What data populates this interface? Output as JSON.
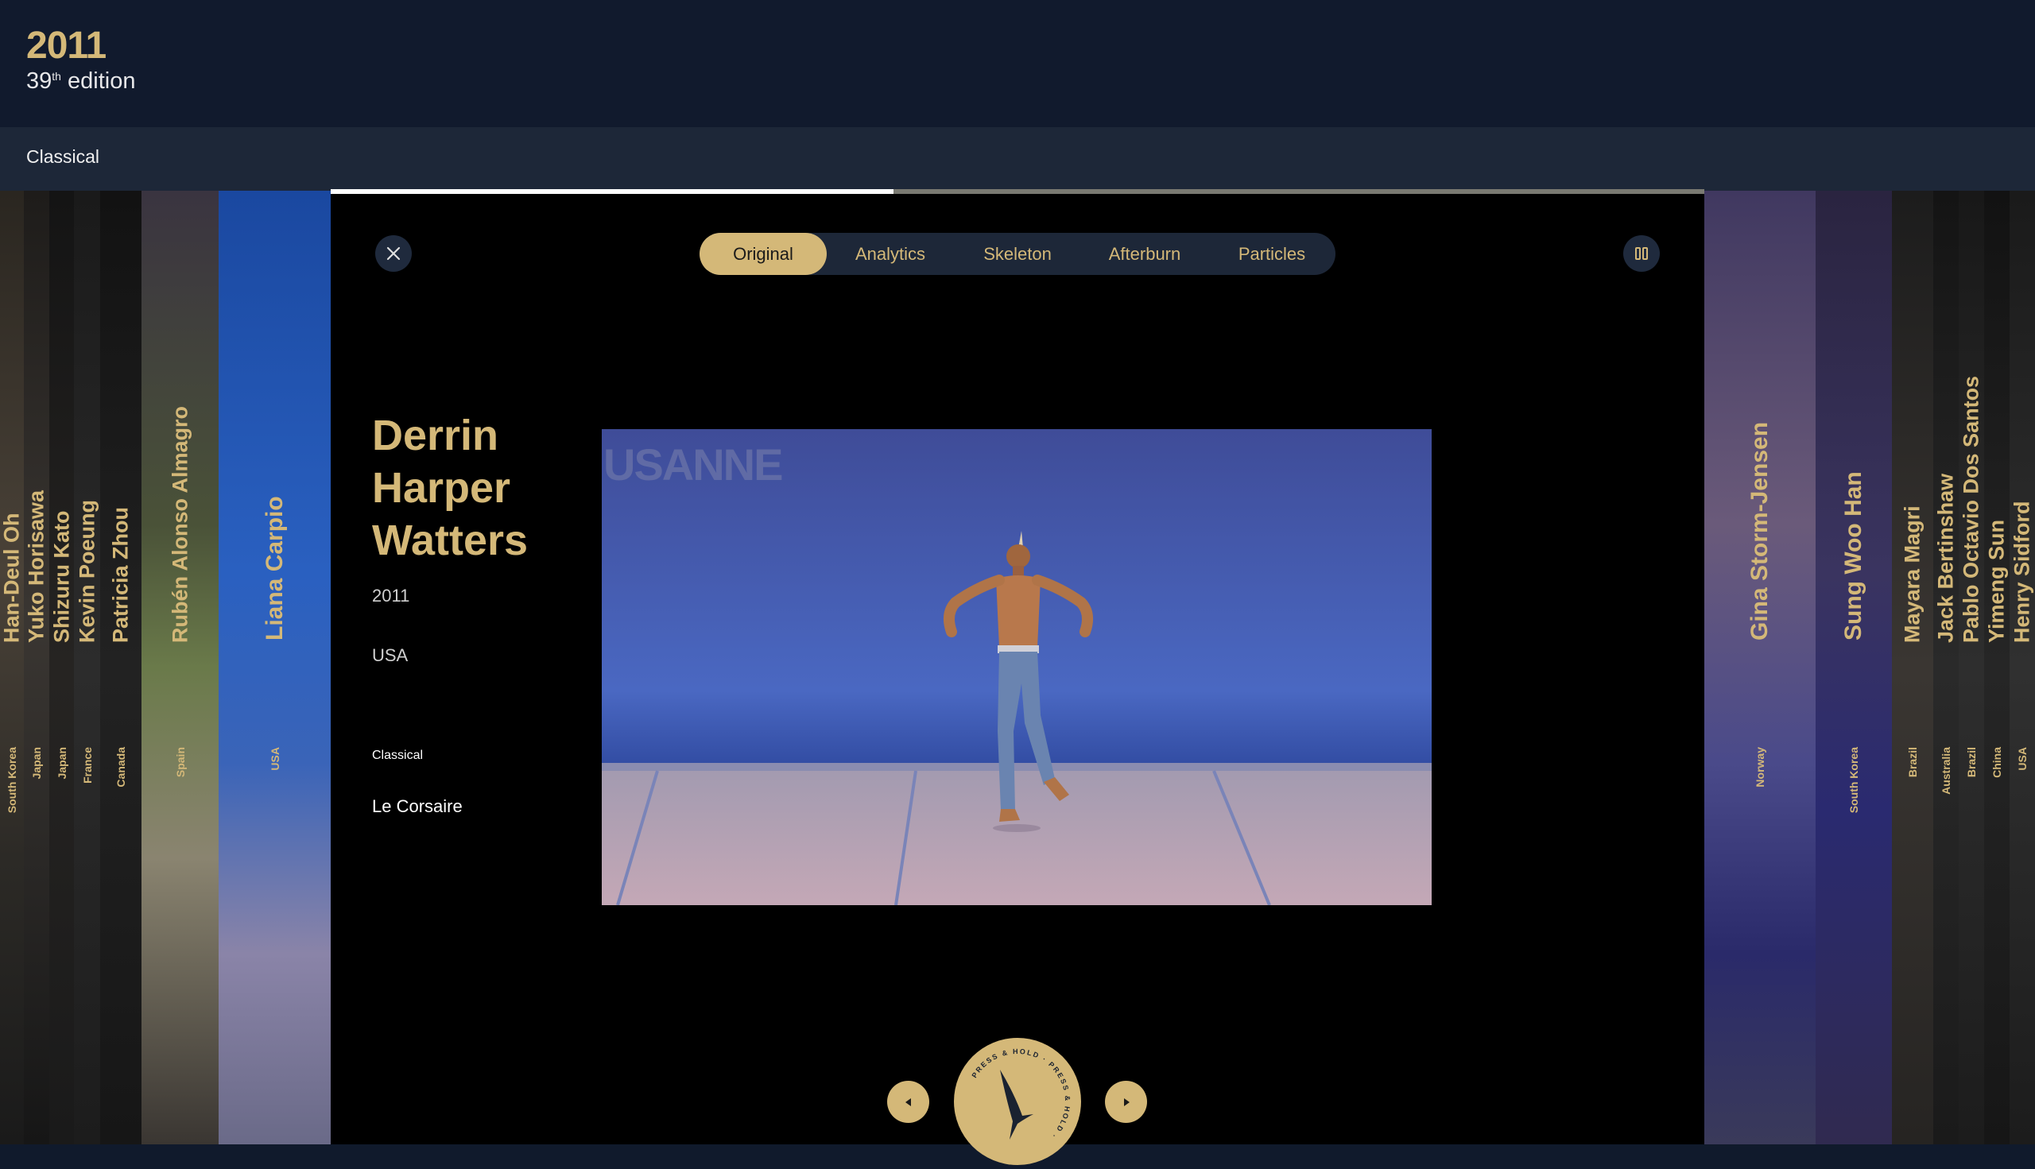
{
  "header": {
    "year": "2011",
    "edition_num": "39",
    "edition_sup": "th",
    "edition_word": " edition"
  },
  "category_bar": {
    "label": "Classical"
  },
  "playback": {
    "progress_fraction": 0.41
  },
  "left_strips": [
    {
      "name": "Han-Deul Oh",
      "country": "South Korea"
    },
    {
      "name": "Yuko Horisawa",
      "country": "Japan"
    },
    {
      "name": "Shizuru Kato",
      "country": "Japan"
    },
    {
      "name": "Kevin Poeung",
      "country": "France"
    },
    {
      "name": "Patricia Zhou",
      "country": "Canada"
    },
    {
      "name": "Rubén Alonso Almagro",
      "country": "Spain"
    },
    {
      "name": "Liana Carpio",
      "country": "USA"
    }
  ],
  "right_strips": [
    {
      "name": "Gina Storm-Jensen",
      "country": "Norway"
    },
    {
      "name": "Sung Woo Han",
      "country": "South Korea"
    },
    {
      "name": "Mayara Magri",
      "country": "Brazil"
    },
    {
      "name": "Jack Bertinshaw",
      "country": "Australia"
    },
    {
      "name": "Pablo Octavio Dos Santos",
      "country": "Brazil"
    },
    {
      "name": "Yimeng Sun",
      "country": "China"
    },
    {
      "name": "Henry Sidford",
      "country": "USA"
    }
  ],
  "modal": {
    "tabs": [
      "Original",
      "Analytics",
      "Skeleton",
      "Afterburn",
      "Particles"
    ],
    "active_tab": "Original",
    "dancer": {
      "name": "Derrin Harper Watters",
      "year": "2011",
      "country": "USA",
      "category": "Classical",
      "piece": "Le Corsaire"
    },
    "video": {
      "banner_text": "USANNE"
    },
    "logo": {
      "ring_text": "PRESS & HOLD · PRESS & HOLD ·"
    }
  },
  "colors": {
    "gold": "#d4b878",
    "navy": "#111a2d",
    "navy_light": "#1d2738"
  },
  "icons": {
    "close": "close-icon",
    "pause": "pause-icon",
    "prev": "caret-left-icon",
    "next": "caret-right-icon",
    "logo": "quill-logo-icon"
  }
}
